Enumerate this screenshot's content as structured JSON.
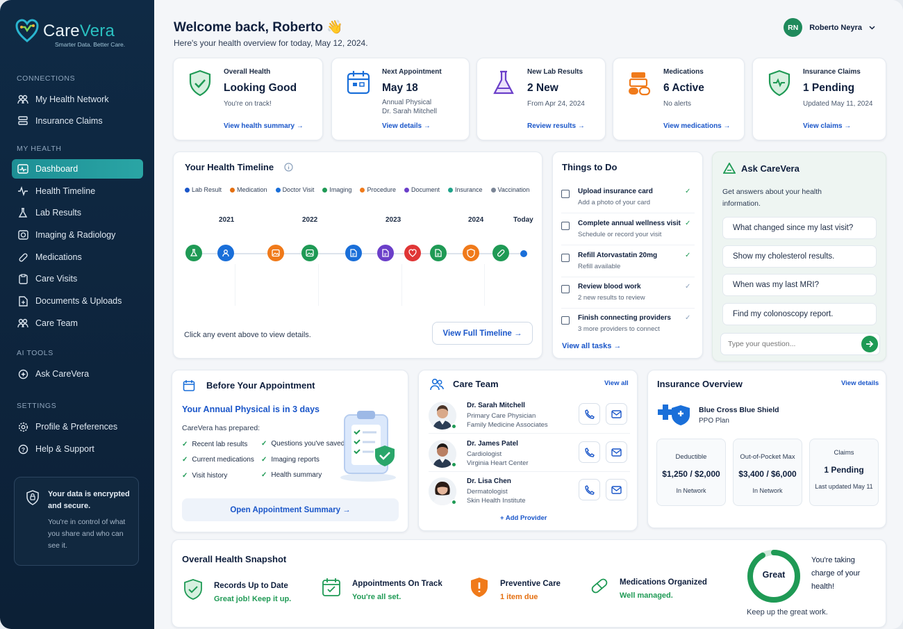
{
  "brand": {
    "name_a": "Care",
    "name_b": "Vera",
    "tagline": "Smarter Data. Better Care."
  },
  "sidebar": {
    "connections_label": "CONNECTIONS",
    "connections": [
      {
        "label": "My Health Network"
      },
      {
        "label": "Insurance Claims"
      }
    ],
    "myhealth_label": "MY HEALTH",
    "myhealth": [
      {
        "label": "Dashboard"
      },
      {
        "label": "Health Timeline"
      },
      {
        "label": "Lab Results"
      },
      {
        "label": "Imaging & Radiology"
      },
      {
        "label": "Medications"
      },
      {
        "label": "Care Visits"
      },
      {
        "label": "Documents & Uploads"
      },
      {
        "label": "Care Team"
      }
    ],
    "aitools_label": "AI TOOLS",
    "aitools": [
      {
        "label": "Ask CareVera"
      }
    ],
    "settings_label": "SETTINGS",
    "settings": [
      {
        "label": "Profile & Preferences"
      },
      {
        "label": "Help & Support"
      }
    ],
    "secure_title": "Your data is encrypted and secure.",
    "secure_text": "You're in control of what you share and who can see it."
  },
  "header": {
    "welcome": "Welcome back, Roberto 👋",
    "subtitle": "Here's your health overview for today, May 12, 2024.",
    "user_initials": "RN",
    "user_name": "Roberto Neyra"
  },
  "stats": [
    {
      "label": "Overall Health",
      "value": "Looking Good",
      "d1": "You're on track!",
      "d2": "",
      "link": "View health summary →"
    },
    {
      "label": "Next Appointment",
      "value": "May 18",
      "d1": "Annual Physical",
      "d2": "Dr. Sarah Mitchell",
      "link": "View details →"
    },
    {
      "label": "New Lab Results",
      "value": "2 New",
      "d1": "From Apr 24, 2024",
      "d2": "",
      "link": "Review results →"
    },
    {
      "label": "Medications",
      "value": "6 Active",
      "d1": "No alerts",
      "d2": "",
      "link": "View medications →"
    },
    {
      "label": "Insurance Claims",
      "value": "1 Pending",
      "d1": "Updated May 11, 2024",
      "d2": "",
      "link": "View claims →"
    }
  ],
  "timeline": {
    "title": "Your Health Timeline",
    "legend": [
      {
        "label": "Lab Result",
        "color": "#1a56c9"
      },
      {
        "label": "Medication",
        "color": "#e46f10"
      },
      {
        "label": "Doctor Visit",
        "color": "#1a6fd9"
      },
      {
        "label": "Imaging",
        "color": "#1f9a55"
      },
      {
        "label": "Procedure",
        "color": "#f07a1a"
      },
      {
        "label": "Document",
        "color": "#6b3fc9"
      },
      {
        "label": "Insurance",
        "color": "#1fa38a"
      },
      {
        "label": "Vaccination",
        "color": "#7a8596"
      }
    ],
    "years": [
      "2021",
      "2022",
      "2023",
      "2024",
      "Today"
    ],
    "events": [
      {
        "color": "#1f9a55",
        "icon": "flask-icon"
      },
      {
        "color": "#1a6fd9",
        "icon": "person-icon"
      },
      {
        "color": "#f07a1a",
        "icon": "image-icon"
      },
      {
        "color": "#1f9a55",
        "icon": "image-icon"
      },
      {
        "color": "#1a6fd9",
        "icon": "document-icon"
      },
      {
        "color": "#6b3fc9",
        "icon": "document-icon"
      },
      {
        "color": "#e03636",
        "icon": "heart-icon"
      },
      {
        "color": "#1f9a55",
        "icon": "document-icon"
      },
      {
        "color": "#f07a1a",
        "icon": "shield-icon"
      },
      {
        "color": "#1f9a55",
        "icon": "pill-icon"
      }
    ],
    "hint": "Click any event above to view details.",
    "button": "View Full Timeline →"
  },
  "todo": {
    "title": "Things to Do",
    "items": [
      {
        "title": "Upload insurance card",
        "sub": "Add a photo of your card"
      },
      {
        "title": "Complete annual wellness visit",
        "sub": "Schedule or record your visit"
      },
      {
        "title": "Refill Atorvastatin 20mg",
        "sub": "Refill available"
      },
      {
        "title": "Review blood work",
        "sub": "2 new results to review"
      },
      {
        "title": "Finish connecting providers",
        "sub": "3 more providers to connect"
      }
    ],
    "link": "View all tasks →"
  },
  "ask": {
    "title": "Ask CareVera",
    "desc": "Get answers about your health information.",
    "questions": [
      "What changed since my last visit?",
      "Show my cholesterol results.",
      "When was my last MRI?",
      "Find my colonoscopy report."
    ],
    "placeholder": "Type your question..."
  },
  "before": {
    "title": "Before Your Appointment",
    "headline": "Your Annual Physical is in 3 days",
    "prepared": "CareVera has prepared:",
    "col1": [
      "Recent lab results",
      "Current medications",
      "Visit history"
    ],
    "col2": [
      "Questions you've saved",
      "Imaging reports",
      "Health summary"
    ],
    "button": "Open Appointment Summary →"
  },
  "careteam": {
    "title": "Care Team",
    "view_all": "View all",
    "doctors": [
      {
        "name": "Dr. Sarah Mitchell",
        "role": "Primary Care Physician",
        "org": "Family Medicine Associates"
      },
      {
        "name": "Dr. James Patel",
        "role": "Cardiologist",
        "org": "Virginia Heart Center"
      },
      {
        "name": "Dr. Lisa Chen",
        "role": "Dermatologist",
        "org": "Skin Health Institute"
      }
    ],
    "add": "+ Add Provider"
  },
  "insurance": {
    "title": "Insurance Overview",
    "view": "View details",
    "provider": "Blue Cross Blue Shield",
    "plan": "PPO Plan",
    "boxes": [
      {
        "a": "Deductible",
        "b": "$1,250 / $2,000",
        "c": "In Network"
      },
      {
        "a": "Out-of-Pocket Max",
        "b": "$3,400 / $6,000",
        "c": "In Network"
      },
      {
        "a": "Claims",
        "b": "1 Pending",
        "c": "Last updated May 11"
      }
    ]
  },
  "snapshot": {
    "title": "Overall Health Snapshot",
    "items": [
      {
        "title": "Records Up to Date",
        "sub": "Great job! Keep it up.",
        "color": "#1f9a55"
      },
      {
        "title": "Appointments On Track",
        "sub": "You're all set.",
        "color": "#1f9a55"
      },
      {
        "title": "Preventive Care",
        "sub": "1 item due",
        "color": "#e46f10"
      },
      {
        "title": "Medications Organized",
        "sub": "Well managed.",
        "color": "#1f9a55"
      }
    ],
    "ring_label": "Great",
    "ring_fraction": 0.92,
    "charge": "You're taking charge of your health!",
    "keep": "Keep up the great work."
  }
}
